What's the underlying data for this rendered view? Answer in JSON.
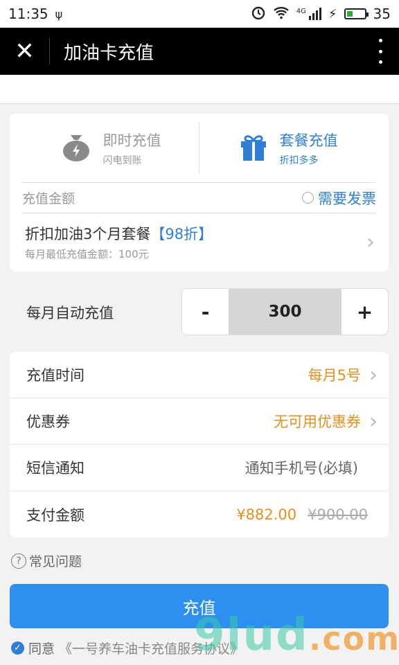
{
  "status_bar": {
    "time": "11:35",
    "usb": "ψ",
    "network": "4G",
    "battery_level": 35,
    "battery": "35"
  },
  "title_bar": {
    "close_icon": "✕",
    "title": "加油卡充值"
  },
  "tabs": [
    {
      "title": "即时充值",
      "subtitle": "闪电到账",
      "icon": "money-bag-icon",
      "active": false
    },
    {
      "title": "套餐充值",
      "subtitle": "折扣多多",
      "icon": "gift-icon",
      "active": true
    }
  ],
  "amount": {
    "label": "充值金额",
    "invoice_label": "需要发票"
  },
  "package": {
    "title": "折扣加油3个月套餐",
    "discount": "【98折】",
    "subtitle": "每月最低充值金额：100元"
  },
  "monthly": {
    "label": "每月自动充值",
    "minus": "-",
    "value": "300",
    "plus": "+"
  },
  "details": {
    "time_label": "充值时间",
    "time_value": "每月5号",
    "coupon_label": "优惠券",
    "coupon_value": "无可用优惠券",
    "sms_label": "短信通知",
    "sms_placeholder": "通知手机号(必填)",
    "pay_label": "支付金额",
    "pay_value": "¥882.00",
    "pay_original": "¥900.00"
  },
  "faq": {
    "label": "常见问题"
  },
  "submit": {
    "label": "充值"
  },
  "agreement": {
    "agree": "同意",
    "link": "《一号养车油卡充值服务协议》"
  },
  "watermark": {
    "main": "9lud",
    "suffix": ".com"
  },
  "colors": {
    "accent": "#2f7fd8",
    "button": "#2d8ff0",
    "orange": "#e58f1e"
  }
}
